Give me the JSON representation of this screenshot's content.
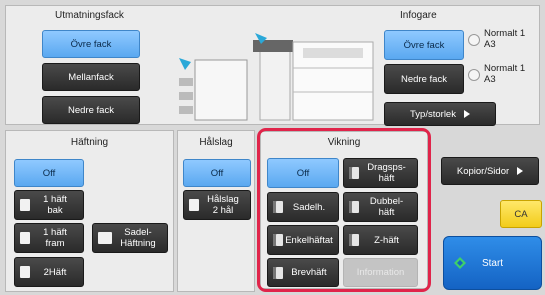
{
  "output_tray": {
    "title": "Utmatningsfack",
    "upper": "Övre fack",
    "middle": "Mellanfack",
    "lower": "Nedre fack"
  },
  "inserter": {
    "title": "Infogare",
    "upper": "Övre fack",
    "lower": "Nedre fack",
    "upper_size": "Normalt 1\nA3",
    "lower_size": "Normalt 1\nA3",
    "type_size": "Typ/storlek"
  },
  "stapling": {
    "title": "Häftning",
    "off": "Off",
    "one_back": "1 häft\nbak",
    "one_front": "1 häft\nfram",
    "saddle": "Sadel-\nHäftning",
    "two": "2Häft"
  },
  "punch": {
    "title": "Hålslag",
    "off": "Off",
    "two_hole": "Hålslag\n2 hål"
  },
  "folding": {
    "title": "Vikning",
    "off": "Off",
    "saddle": "Sadelh.",
    "single": "Enkelhäftat",
    "letter": "Brevhäft",
    "accordion": "Dragsps-\nhäft",
    "double": "Dubbel-\nhäft",
    "z": "Z-häft",
    "info": "Information"
  },
  "side": {
    "copies": "Kopior/Sidor",
    "ca": "CA",
    "start": "Start"
  },
  "colors": {
    "highlight": "#e0244a",
    "selected": "#5aa8f0"
  }
}
